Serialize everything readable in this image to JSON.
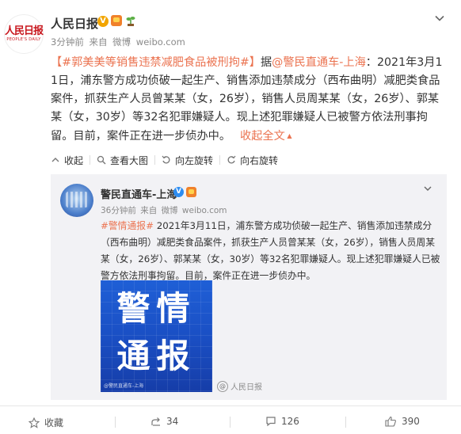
{
  "header": {
    "avatar_logo_cn": "人民日报",
    "avatar_logo_en": "PEOPLE'S DAILY",
    "user_name": "人民日报",
    "v_badge": "V",
    "time": "3分钟前",
    "source_prefix": "来自",
    "source": "微博",
    "site": "weibo.com"
  },
  "post": {
    "hashtag": "【#郭美美等销售违禁减肥食品被刑拘#】",
    "text_prefix": "据",
    "mention": "@警民直通车-上海",
    "text_body": "：2021年3月11日，浦东警方成功侦破一起生产、销售添加违禁成分（西布曲明）减肥类食品案件，抓获生产人员曾某某（女，26岁），销售人员周某某（女，26岁）、郭某某（女，30岁）等32名犯罪嫌疑人。现上述犯罪嫌疑人已被警方依法刑事拘留。目前，案件正在进一步侦办中。",
    "collapse_label": "收起全文"
  },
  "toolbar": {
    "collapse": "收起",
    "view_large": "查看大图",
    "rotate_left": "向左旋转",
    "rotate_right": "向右旋转"
  },
  "repost": {
    "user_name": "警民直通车-上海",
    "v_badge": "V",
    "time": "36分钟前",
    "source_prefix": "来自",
    "source": "微博",
    "site": "weibo.com",
    "hashtag": "#警情通报#",
    "text_body": " 2021年3月11日，浦东警方成功侦破一起生产、销售添加违禁成分（西布曲明）减肥类食品案件，抓获生产人员曾某某（女，26岁），销售人员周某某（女，26岁）、郭某某（女，30岁）等32名犯罪嫌疑人。现上述犯罪嫌疑人已被警方依法刑事拘留。目前，案件正在进一步侦办中。",
    "image_line1": "警情",
    "image_line2": "通报",
    "image_watermark": "@警民直通车-上海",
    "watermark": "人民日报"
  },
  "bottom": {
    "favorite": "收藏",
    "repost_count": "34",
    "comment_count": "126",
    "like_count": "390"
  },
  "colors": {
    "link": "#eb7350",
    "repost_bg": "#f2f2f5",
    "brand_red": "#c8161d"
  }
}
